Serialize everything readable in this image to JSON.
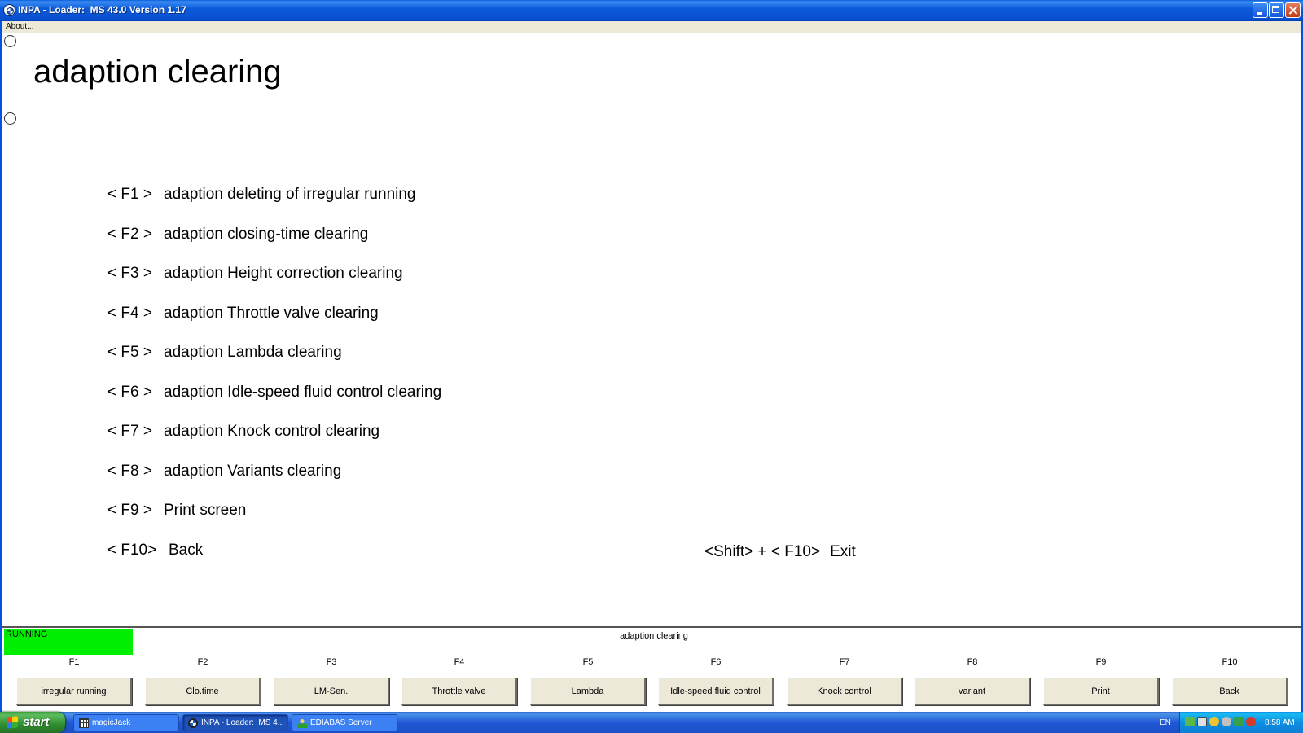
{
  "window": {
    "title": "INPA - Loader:  MS 43.0 Version 1.17",
    "menu": [
      "About..."
    ]
  },
  "main": {
    "title": "adaption clearing",
    "menu_rows": [
      {
        "key": "< F1 >",
        "label": "adaption deleting of irregular running"
      },
      {
        "key": "< F2 >",
        "label": "adaption closing-time clearing"
      },
      {
        "key": "< F3 >",
        "label": "adaption Height correction clearing"
      },
      {
        "key": "< F4 >",
        "label": "adaption Throttle valve clearing"
      },
      {
        "key": "< F5 >",
        "label": "adaption Lambda clearing"
      },
      {
        "key": "< F6 >",
        "label": "adaption Idle-speed fluid control clearing"
      },
      {
        "key": "< F7 >",
        "label": "adaption Knock control clearing"
      },
      {
        "key": "< F8 >",
        "label": "adaption Variants clearing"
      },
      {
        "key": "< F9 >",
        "label": "Print screen"
      },
      {
        "key": "< F10>",
        "label": "Back"
      }
    ],
    "exit": {
      "key": "<Shift> + < F10>",
      "label": "Exit"
    }
  },
  "status": {
    "state": "RUNNING",
    "state_color": "#00ee00",
    "screen_title": "adaption clearing"
  },
  "fkeys": [
    {
      "key": "F1",
      "label": "irregular running"
    },
    {
      "key": "F2",
      "label": "Clo.time"
    },
    {
      "key": "F3",
      "label": "LM-Sen."
    },
    {
      "key": "F4",
      "label": "Throttle valve"
    },
    {
      "key": "F5",
      "label": "Lambda"
    },
    {
      "key": "F6",
      "label": "Idle-speed fluid control"
    },
    {
      "key": "F7",
      "label": "Knock control"
    },
    {
      "key": "F8",
      "label": "variant"
    },
    {
      "key": "F9",
      "label": "Print"
    },
    {
      "key": "F10",
      "label": "Back"
    }
  ],
  "taskbar": {
    "start_label": "start",
    "tasks": [
      {
        "label": "magicJack",
        "icon": "grid-icon",
        "active": false
      },
      {
        "label": "INPA - Loader:  MS 4...",
        "icon": "bmw-icon",
        "active": true
      },
      {
        "label": "EDIABAS Server",
        "icon": "person-icon",
        "active": false
      }
    ],
    "language": "EN",
    "clock": "8:58 AM"
  }
}
